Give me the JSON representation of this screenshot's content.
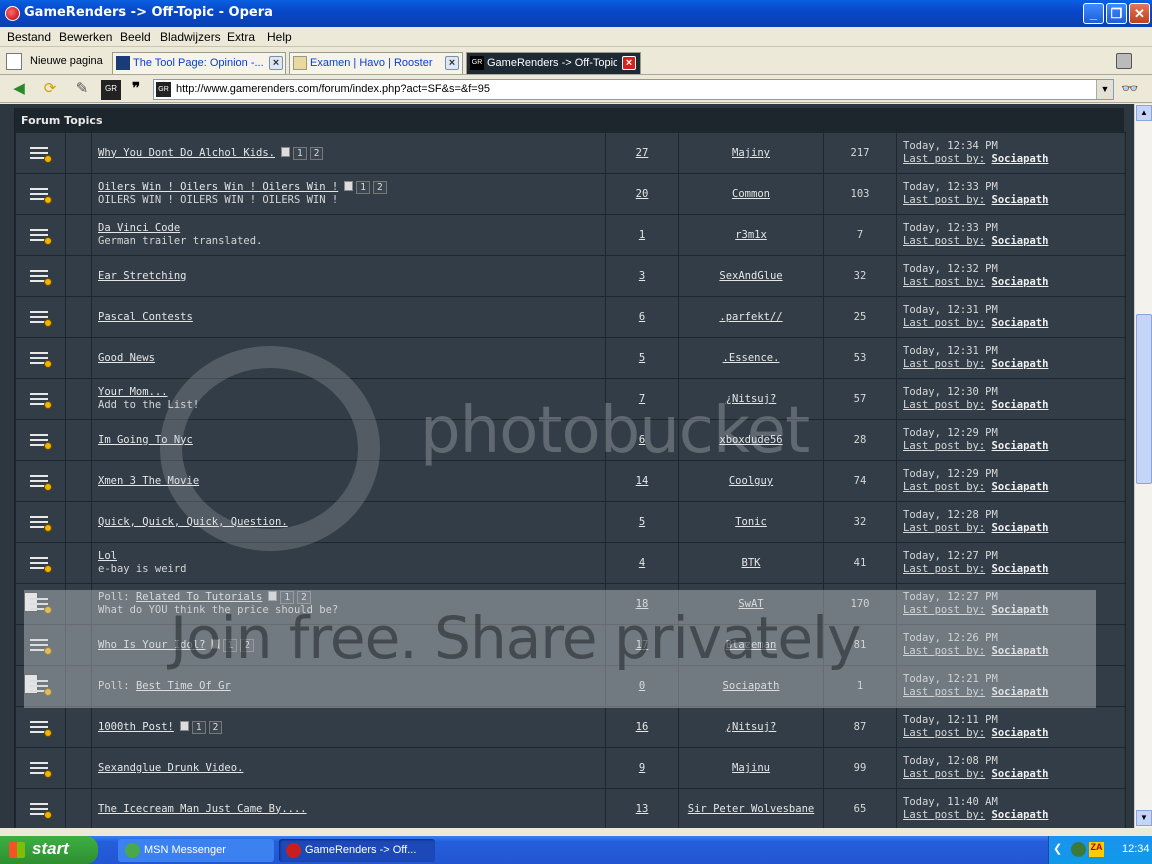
{
  "window": {
    "title": "GameRenders -> Off-Topic - Opera"
  },
  "menu": [
    "Bestand",
    "Bewerken",
    "Beeld",
    "Bladwijzers",
    "Extra",
    "Help"
  ],
  "tabs": {
    "new_page": "Nieuwe pagina",
    "items": [
      {
        "label": "The Tool Page: Opinion -..."
      },
      {
        "label": "Examen | Havo | Rooster"
      },
      {
        "label": "GameRenders -> Off-Topic"
      }
    ]
  },
  "nav": {
    "url": "http://www.gamerenders.com/forum/index.php?act=SF&s=&f=95",
    "url_favicon": "GR"
  },
  "forum": {
    "heading": "Forum Topics",
    "last_by_label": "Last post by:",
    "topics": [
      {
        "prefix": "",
        "title": "Why You Dont Do Alchol Kids.",
        "pages": [
          "1",
          "2"
        ],
        "desc": "",
        "replies": "27",
        "starter": "Majiny",
        "views": "217",
        "last_time": "Today, 12:34 PM",
        "last_user": "Sociapath"
      },
      {
        "prefix": "",
        "title": "Oilers Win ! Oilers Win ! Oilers Win !",
        "pages": [
          "1",
          "2"
        ],
        "desc": "OILERS WIN ! OILERS WIN ! OILERS WIN !",
        "replies": "20",
        "starter": "Common",
        "views": "103",
        "last_time": "Today, 12:33 PM",
        "last_user": "Sociapath"
      },
      {
        "prefix": "",
        "title": "Da Vinci Code",
        "pages": [],
        "desc": "German trailer translated.",
        "replies": "1",
        "starter": "r3m1x",
        "views": "7",
        "last_time": "Today, 12:33 PM",
        "last_user": "Sociapath"
      },
      {
        "prefix": "",
        "title": "Ear Stretching",
        "pages": [],
        "desc": "",
        "replies": "3",
        "starter": "SexAndGlue",
        "views": "32",
        "last_time": "Today, 12:32 PM",
        "last_user": "Sociapath"
      },
      {
        "prefix": "",
        "title": "Pascal Contests",
        "pages": [],
        "desc": "",
        "replies": "6",
        "starter": ".parfekt//",
        "views": "25",
        "last_time": "Today, 12:31 PM",
        "last_user": "Sociapath"
      },
      {
        "prefix": "",
        "title": "Good News",
        "pages": [],
        "desc": "",
        "replies": "5",
        "starter": ".Essence.",
        "views": "53",
        "last_time": "Today, 12:31 PM",
        "last_user": "Sociapath"
      },
      {
        "prefix": "",
        "title": "Your Mom...",
        "pages": [],
        "desc": "Add to the List!",
        "replies": "7",
        "starter": "¿Nitsuj?",
        "views": "57",
        "last_time": "Today, 12:30 PM",
        "last_user": "Sociapath"
      },
      {
        "prefix": "",
        "title": "Im Going To Nyc",
        "pages": [],
        "desc": "",
        "replies": "6",
        "starter": "xboxdude56",
        "views": "28",
        "last_time": "Today, 12:29 PM",
        "last_user": "Sociapath"
      },
      {
        "prefix": "",
        "title": "Xmen 3 The Movie",
        "pages": [],
        "desc": "",
        "replies": "14",
        "starter": "Coolguy",
        "views": "74",
        "last_time": "Today, 12:29 PM",
        "last_user": "Sociapath"
      },
      {
        "prefix": "",
        "title": "Quick, Quick, Quick, Question.",
        "pages": [],
        "desc": "",
        "replies": "5",
        "starter": "Tonic",
        "views": "32",
        "last_time": "Today, 12:28 PM",
        "last_user": "Sociapath"
      },
      {
        "prefix": "",
        "title": "Lol",
        "pages": [],
        "desc": "e-bay is weird",
        "replies": "4",
        "starter": "BTK",
        "views": "41",
        "last_time": "Today, 12:27 PM",
        "last_user": "Sociapath"
      },
      {
        "prefix": "Poll:",
        "title": "Related To Tutorials",
        "pages": [
          "1",
          "2"
        ],
        "desc": "What do YOU think the price should be?",
        "replies": "18",
        "starter": "SwAT",
        "views": "170",
        "last_time": "Today, 12:27 PM",
        "last_user": "Sociapath"
      },
      {
        "prefix": "",
        "title": "Who Is Your Idol?",
        "pages": [
          "1",
          "2"
        ],
        "desc": "",
        "replies": "17",
        "starter": "Blazeman",
        "views": "81",
        "last_time": "Today, 12:26 PM",
        "last_user": "Sociapath"
      },
      {
        "prefix": "Poll:",
        "title": "Best Time Of Gr",
        "pages": [],
        "desc": "",
        "replies": "0",
        "starter": "Sociapath",
        "views": "1",
        "last_time": "Today, 12:21 PM",
        "last_user": "Sociapath"
      },
      {
        "prefix": "",
        "title": "1000th Post!",
        "pages": [
          "1",
          "2"
        ],
        "desc": "",
        "replies": "16",
        "starter": "¿Nitsuj?",
        "views": "87",
        "last_time": "Today, 12:11 PM",
        "last_user": "Sociapath"
      },
      {
        "prefix": "",
        "title": "Sexandglue Drunk Video.",
        "pages": [],
        "desc": "",
        "replies": "9",
        "starter": "Majinu",
        "views": "99",
        "last_time": "Today, 12:08 PM",
        "last_user": "Sociapath"
      },
      {
        "prefix": "",
        "title": "The Icecream Man Just Came By....",
        "pages": [],
        "desc": "",
        "replies": "13",
        "starter": "Sir Peter Wolvesbane",
        "views": "65",
        "last_time": "Today, 11:40 AM",
        "last_user": "Sociapath"
      }
    ]
  },
  "watermark": {
    "logo": "photobucket",
    "band": "Join free. Share privately"
  },
  "taskbar": {
    "start": "start",
    "items": [
      {
        "label": "MSN Messenger"
      },
      {
        "label": "GameRenders -> Off..."
      }
    ],
    "clock": "12:34"
  },
  "colors": {
    "page_bg": "#2d3740",
    "row_bg": "#323d47",
    "accent": "#f0b400"
  }
}
